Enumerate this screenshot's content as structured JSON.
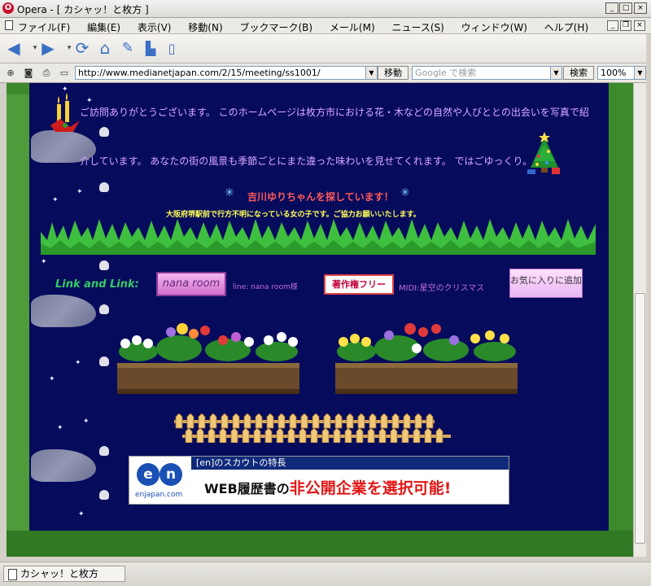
{
  "window": {
    "title": "Opera - [ カシャッ！と枚方 ]",
    "minimize": "_",
    "maximize": "□",
    "close": "×"
  },
  "menu": {
    "items": [
      "ファイル(F)",
      "編集(E)",
      "表示(V)",
      "移動(N)",
      "ブックマーク(B)",
      "メール(M)",
      "ニュース(S)",
      "ウィンドウ(W)",
      "ヘルプ(H)"
    ]
  },
  "navigation": {
    "icons": [
      "back-arrow-icon",
      "forward-arrow-icon",
      "reload-icon",
      "home-icon",
      "hotlist-icon",
      "print-icon",
      "document-icon"
    ]
  },
  "address": {
    "url": "http://www.medianetjapan.com/2/15/meeting/ss1001/",
    "go_label": "移動",
    "search_placeholder": "Google で検索",
    "search_button": "検索",
    "zoom": "100%"
  },
  "page": {
    "intro_line1": "ご訪問ありがとうございます。 このホームページは枚方市における花・木などの自然や人びととの出会いを写真で紹",
    "intro_line2": "介しています。 あなたの街の風景も季節ごとにまた違った味わいを見せてくれます。 ではごゆっくり。",
    "missing_title": "吉川ゆりちゃんを探しています！",
    "missing_sub": "大阪府堺駅前で行方不明になっている女の子です。ご協力お願いいたします。",
    "link_label": "Link and Link:",
    "nana_button": "nana room",
    "nana_link": "line: nana room様",
    "copyright_button": "著作権フリー",
    "midi_link": "MIDI:星空のクリスマス",
    "favorite_button": "お気に入りに追加",
    "banner": {
      "logo": "en",
      "url": "enjapan.com",
      "header": "[en]のスカウトの特長",
      "line_prefix": "WEB履歴書の",
      "line_highlight": "非公開企業を選択可能!"
    }
  },
  "status": {
    "text": "カシャッ！と枚方"
  },
  "colors": {
    "page_background": "#070b5c",
    "border_green": "#4d9b3a",
    "intro_text": "#d8a8ff",
    "alert_red": "#ff5a5a",
    "alert_yellow": "#ffff55",
    "link_label": "#33cc66"
  }
}
